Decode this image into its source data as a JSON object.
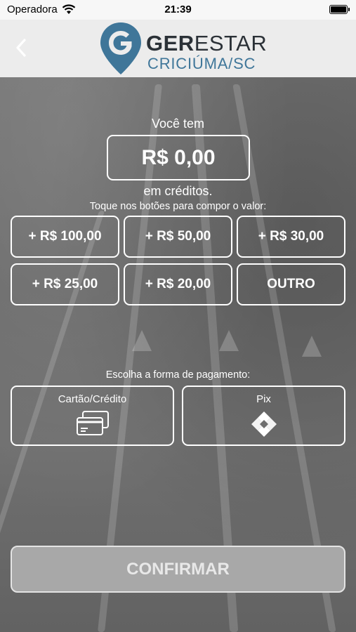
{
  "status_bar": {
    "carrier": "Operadora",
    "time": "21:39"
  },
  "header": {
    "logo": {
      "brand_bold": "GER",
      "brand_rest": "ESTAR",
      "city": "CRICIÚMA/SC"
    },
    "colors": {
      "logo_blue": "#3f7699",
      "logo_dark": "#2b3137"
    }
  },
  "credit": {
    "prefix_label": "Você tem",
    "amount": "R$ 0,00",
    "suffix_label": "em créditos.",
    "hint": "Toque nos botões para compor o valor:"
  },
  "value_buttons": [
    {
      "label": "+ R$ 100,00"
    },
    {
      "label": "+ R$ 50,00"
    },
    {
      "label": "+ R$ 30,00"
    },
    {
      "label": "+ R$ 25,00"
    },
    {
      "label": "+ R$ 20,00"
    },
    {
      "label": "OUTRO"
    }
  ],
  "payment": {
    "label": "Escolha a forma de pagamento:",
    "methods": [
      {
        "label": "Cartão/Crédito",
        "icon": "credit-cards-icon"
      },
      {
        "label": "Pix",
        "icon": "pix-icon"
      }
    ]
  },
  "confirm": {
    "label": "CONFIRMAR"
  }
}
